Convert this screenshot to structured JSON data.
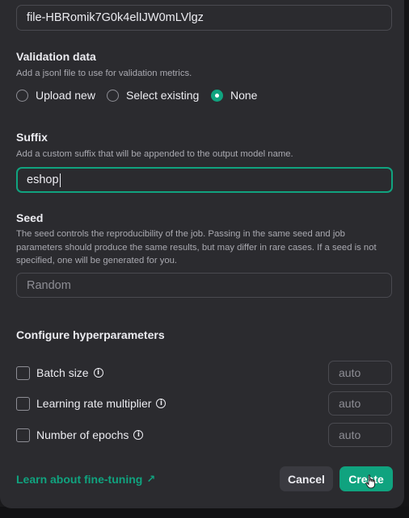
{
  "training_file": {
    "value": "file-HBRomik7G0k4elIJW0mLVlgz"
  },
  "validation": {
    "title": "Validation data",
    "description": "Add a jsonl file to use for validation metrics.",
    "options": [
      {
        "label": "Upload new",
        "selected": false
      },
      {
        "label": "Select existing",
        "selected": false
      },
      {
        "label": "None",
        "selected": true
      }
    ]
  },
  "suffix": {
    "title": "Suffix",
    "description": "Add a custom suffix that will be appended to the output model name.",
    "value": "eshop"
  },
  "seed": {
    "title": "Seed",
    "description": "The seed controls the reproducibility of the job. Passing in the same seed and job parameters should produce the same results, but may differ in rare cases. If a seed is not specified, one will be generated for you.",
    "placeholder": "Random"
  },
  "hyperparameters": {
    "title": "Configure hyperparameters",
    "items": [
      {
        "label": "Batch size",
        "value": "auto",
        "checked": false
      },
      {
        "label": "Learning rate multiplier",
        "value": "auto",
        "checked": false
      },
      {
        "label": "Number of epochs",
        "value": "auto",
        "checked": false
      }
    ]
  },
  "footer": {
    "learn_link": "Learn about fine-tuning",
    "cancel_label": "Cancel",
    "create_label": "Create"
  },
  "colors": {
    "accent": "#10a37f",
    "modal_bg": "#2b2b2f",
    "text": "#ececf1",
    "muted": "#a9a9b0"
  }
}
